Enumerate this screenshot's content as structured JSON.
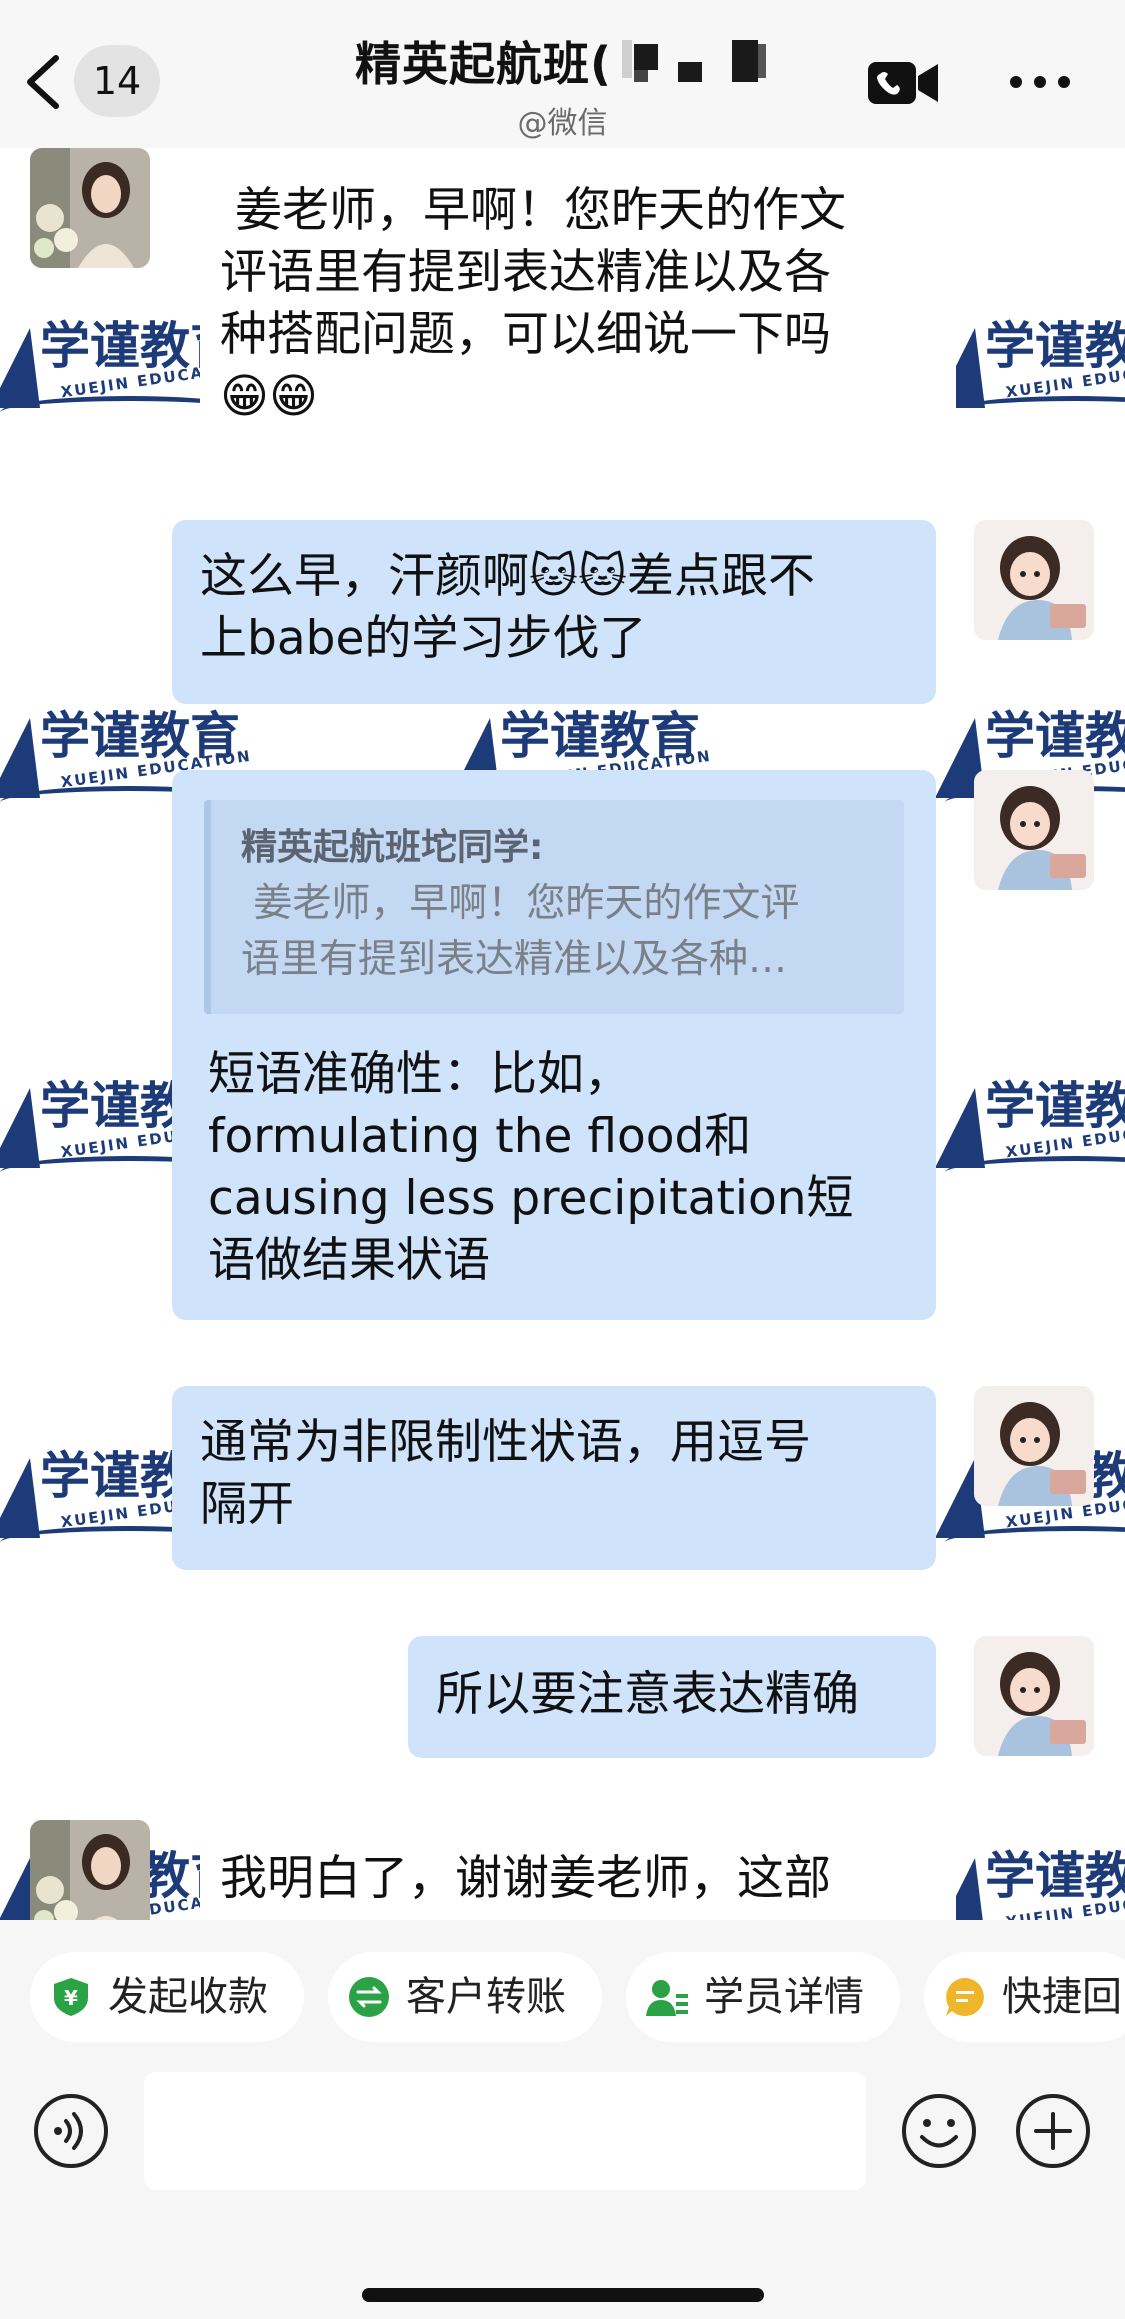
{
  "header": {
    "back_label": "<",
    "unread_count": "14",
    "title": "精英起航班(",
    "subtitle": "@微信",
    "video_icon": "video-call-icon",
    "more_icon": "more-icon"
  },
  "watermark": {
    "text": "学谨教育",
    "sub": "XUEJIN EDUCATION",
    "color": "#1d3b79"
  },
  "messages": [
    {
      "side": "left",
      "text": " 姜老师，早啊！您昨天的作文\n评语里有提到表达精准以及各\n种搭配问题，可以细说一下吗\n😁😁"
    },
    {
      "side": "right",
      "text": "这么早，汗颜啊🐱🐱差点跟不\n上babe的学习步伐了"
    },
    {
      "side": "right",
      "quote_author": "精英起航班坨同学:",
      "quote_text": " 姜老师，早啊！您昨天的作文评\n语里有提到表达精准以及各种…",
      "text": "短语准确性：比如，\nformulating the flood和\ncausing less precipitation短\n语做结果状语"
    },
    {
      "side": "right",
      "text": "通常为非限制性状语，用逗号\n隔开"
    },
    {
      "side": "right",
      "text": "所以要注意表达精确"
    },
    {
      "side": "left",
      "text": "我明白了，谢谢姜老师，这部"
    }
  ],
  "quick_actions": [
    {
      "label": "发起收款",
      "icon": "payment-shield-icon",
      "color": "#2ba245"
    },
    {
      "label": "客户转账",
      "icon": "transfer-icon",
      "color": "#2ba245"
    },
    {
      "label": "学员详情",
      "icon": "student-detail-icon",
      "color": "#2ba245"
    },
    {
      "label": "快捷回",
      "icon": "quick-reply-icon",
      "color": "#f0b62b"
    }
  ],
  "input": {
    "voice_icon": "voice-icon",
    "emoji_icon": "emoji-icon",
    "plus_icon": "plus-icon",
    "value": ""
  }
}
